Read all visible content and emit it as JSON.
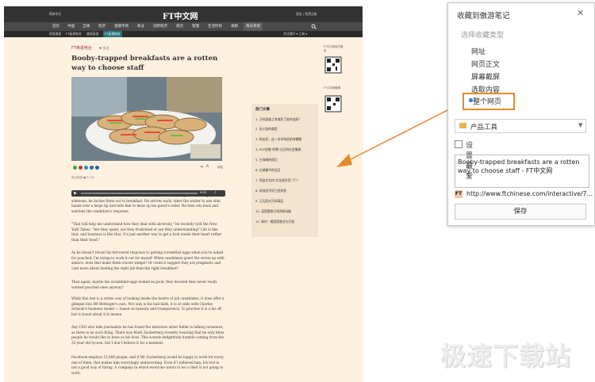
{
  "ft": {
    "top_left": "简体中文",
    "logo": "FT中文网",
    "top_right": "登录 | 免费注册",
    "nav": [
      "首页",
      "中国",
      "全球",
      "经济",
      "金融市场",
      "商业",
      "创新经济",
      "观点",
      "管理",
      "生活时尚",
      "视频",
      "每日英语"
    ],
    "subnav": [
      "双语阅读",
      "FT英语电台",
      "速读英语",
      "FT英语电台"
    ],
    "subnav_right": "关注我们 ▾  工具 ▾",
    "category": "FT英语电台",
    "title": "Booby-trapped breakfasts are a rotten way to choose staff",
    "audio_time": "0:00",
    "caption": "每日英语 ● 5.0.8.",
    "paragraphs": [
      "When Walt Bettinger, chief executive of Charles Schwab, is thinking about hiring someone, he invites them out to breakfast. He arrives early, takes the waiter to one side, hands over a large tip and tells him to mess up his guest's order. He then sits back and watches the candidate's response.",
      "\"That will help me understand how they deal with adversity,\" he recently told the New York Times. \"Are they upset, are they frustrated or are they understanding? Life is like that, and business is like that. It's just another way to get a look inside their heart rather than their head.\"",
      "As he doesn't reveal his fervoured response to getting scrambled eggs when you've asked for poached, I'm trying to work it out for myself. When candidates greet the screw-up with silence, does that make them craven wimps? Or could it suggest they are pragmatic and care more about landing the right job than the right breakfast?",
      "Then again, maybe the scrambled eggs looked as good, they decided they never really wanted poached ones anyway?",
      "While this test is a rotten way of looking inside the hearts of job candidates, it does offer a glimpse into Mr Bettinger's own. Not only is his bad faith, it is at odds with Charles Schwab's business model — based on honesty and transparency. To practise it is a bit off, but to boast about it is insane.",
      "Any CEO who tells journalists he has found the interview silver bullet is talking nonsense, as there is no such thing. There was Mark Zuckerberg recently insisting that he only hires people he would like to have as his boss. This sounds delightfully humble coming from the 32-year-old tycoon, but I don't believe it for a moment.",
      "Facebook employs 15,000 people, and if Mr Zuckerberg would be happy to work for every one of them, that makes him worryingly undiscerning. Even if I believed him, his test is not a good way of hiring. A company in which everyone wants to be a chief is not going to work."
    ],
    "hot_title": "热门文章",
    "hot_items": [
      "1. 万科面临之争激烈了谁的战局？",
      "2. 张小龙的尊容",
      "3. 陈志武：这一次市场会如何撑腰",
      "4. P2P金融\"杀鹅\"之后的社会情绪",
      "5. 白海琳的相识",
      "6. 白城塞牛的远见",
      "7. 到这次为何\"文化相关官\"了\"？",
      "8. 安倍经济学已经失败",
      "9. 王石面对万科高层",
      "10. 英国脱欧已再添新动能",
      "11. 新村：美国是就业与开放"
    ],
    "qr_labels": [
      "FT中文网官方微信",
      "FT中文网微博"
    ]
  },
  "panel": {
    "title": "收藏到傲游笔记",
    "close": "✕",
    "type_header": "选择收藏类型",
    "options": [
      "网址",
      "网页正文",
      "屏幕截屏",
      "选取内容",
      "整个网页"
    ],
    "selected_option": "整个网页",
    "folder": "产品工具",
    "folder_chevron": "▼",
    "set_favorite": "设置最爱",
    "note_title": "Booby-trapped breakfasts are a rotten way to choose staff - FT中文网",
    "url_icon": "FT",
    "url": "http://www.ftchinese.com/interactive/7...",
    "save": "保存"
  },
  "watermark": "极速下载站",
  "colors": {
    "accent": "#e58a2e",
    "ft_bg": "#fff1e0",
    "ft_dark": "#333333",
    "selected_dot": "#3a7bd5"
  }
}
